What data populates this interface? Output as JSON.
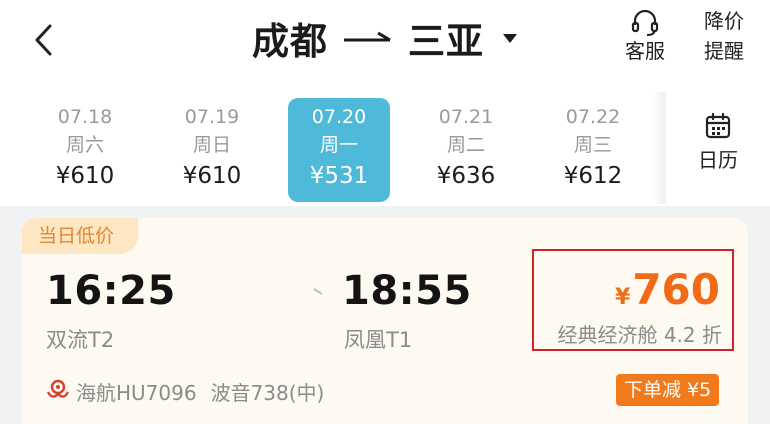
{
  "header": {
    "from_city": "成都",
    "to_city": "三亚",
    "service_label": "客服",
    "alert_label_1": "降价",
    "alert_label_2": "提醒"
  },
  "dates": [
    {
      "date": "07.18",
      "weekday": "周六",
      "price": "¥610",
      "active": false
    },
    {
      "date": "07.19",
      "weekday": "周日",
      "price": "¥610",
      "active": false
    },
    {
      "date": "07.20",
      "weekday": "周一",
      "price": "¥531",
      "active": true
    },
    {
      "date": "07.21",
      "weekday": "周二",
      "price": "¥636",
      "active": false
    },
    {
      "date": "07.22",
      "weekday": "周三",
      "price": "¥612",
      "active": false
    }
  ],
  "calendar": {
    "label": "日历"
  },
  "flight": {
    "tag": "当日低价",
    "dep_time": "16:25",
    "dep_airport": "双流T2",
    "arr_time": "18:55",
    "arr_airport": "凤凰T1",
    "currency": "¥",
    "price": "760",
    "cabin": "经典经济舱 4.2 折",
    "airline": "海航HU7096",
    "aircraft": "波音738(中)",
    "discount": "下单减 ¥5"
  },
  "colors": {
    "accent": "#4fb9d9",
    "price": "#f06a17",
    "tag_bg": "#fde7c3",
    "tag_text": "#e8842a",
    "highlight_border": "#d2202a"
  }
}
